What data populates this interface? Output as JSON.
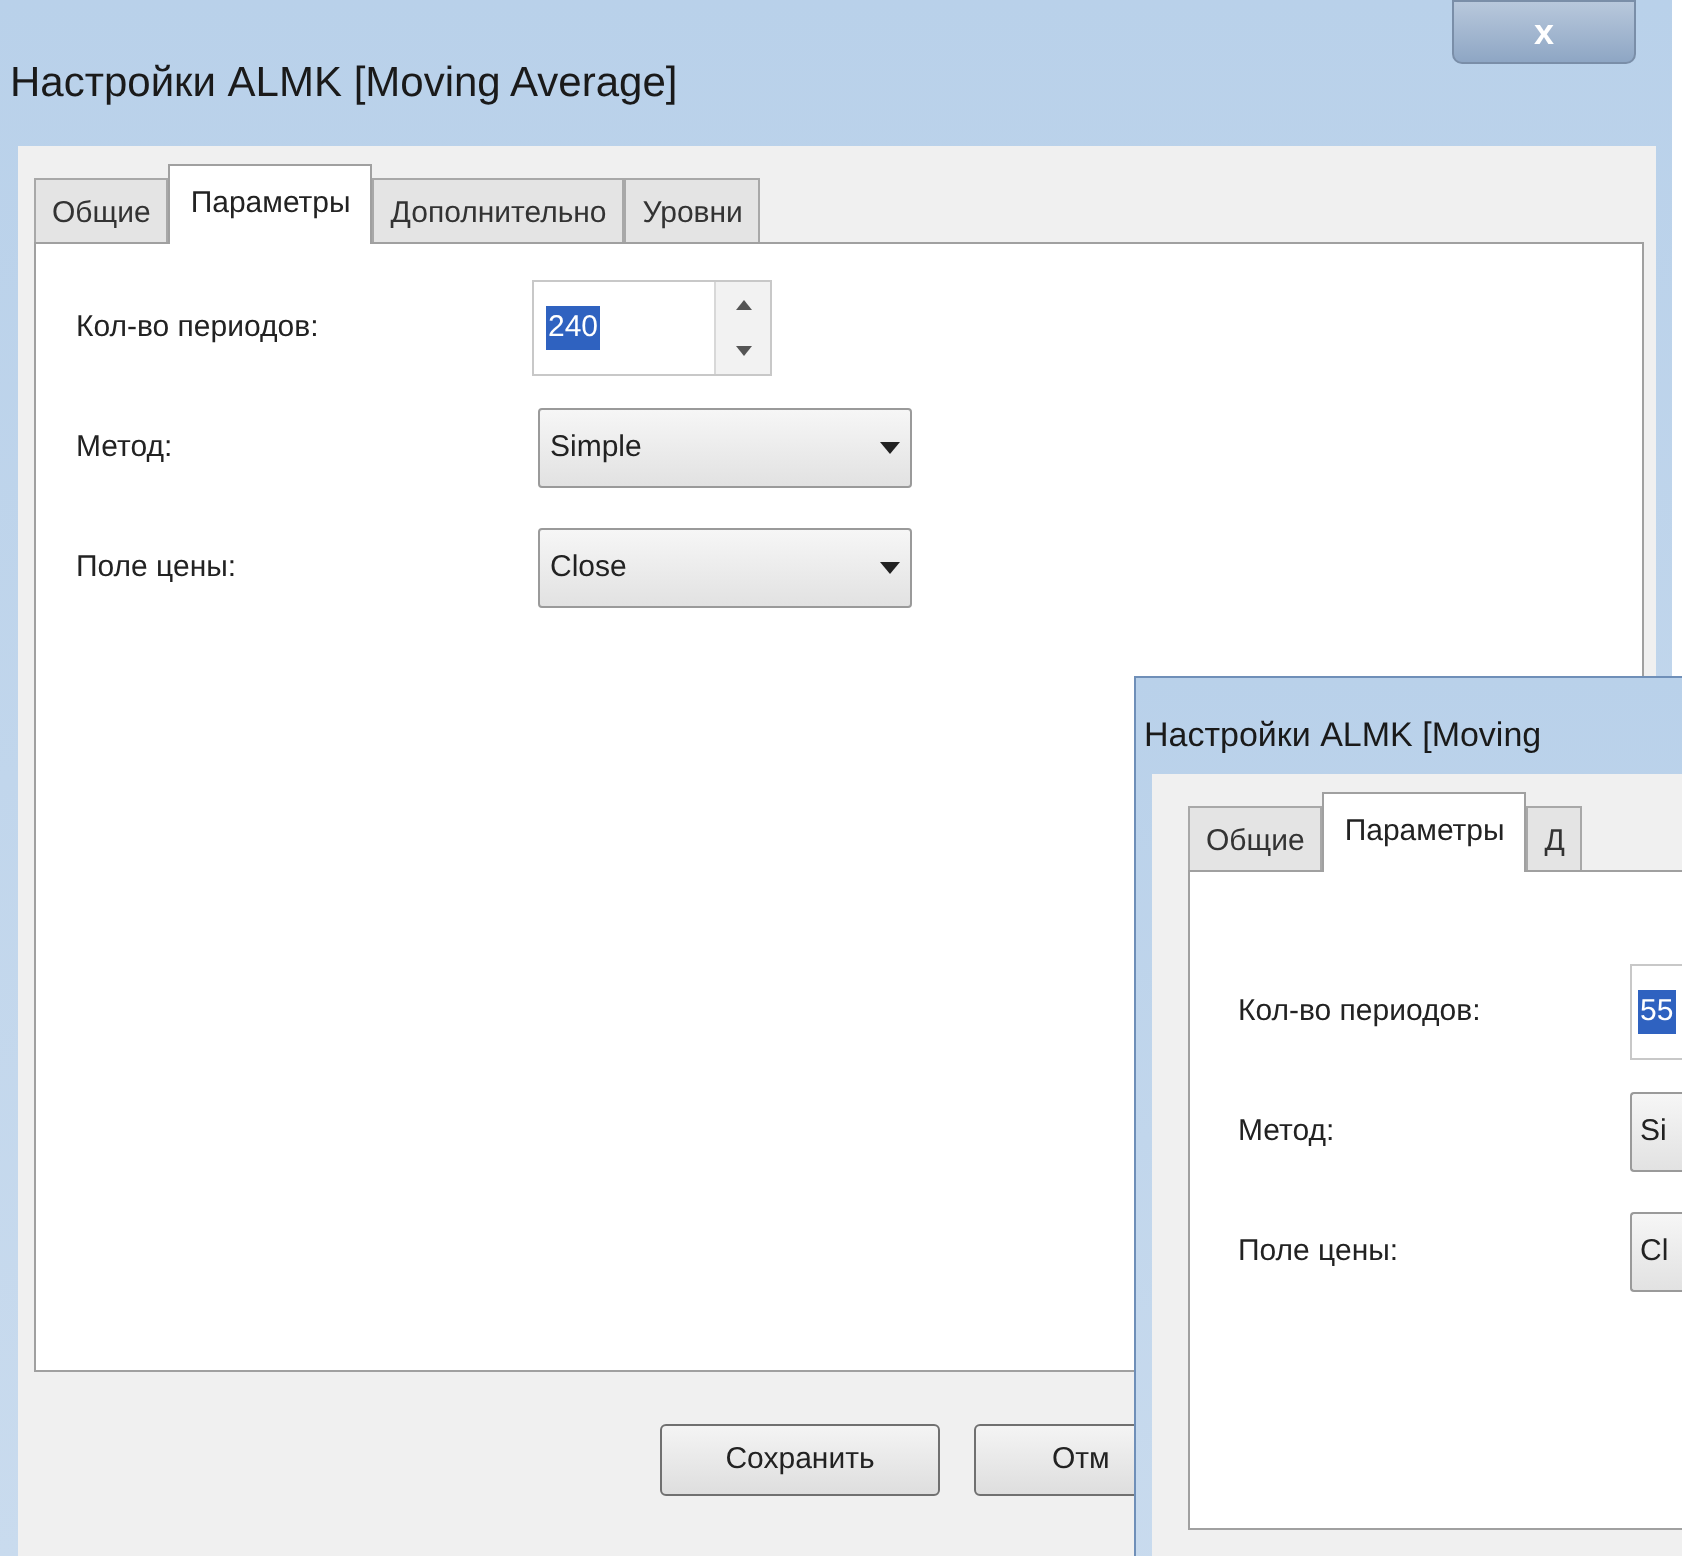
{
  "dialogs": [
    {
      "title": "Настройки ALMK [Moving Average]",
      "close": "x",
      "tabs": [
        {
          "label": "Общие",
          "selected": false
        },
        {
          "label": "Параметры",
          "selected": true
        },
        {
          "label": "Дополнительно",
          "selected": false
        },
        {
          "label": "Уровни",
          "selected": false
        }
      ],
      "fields": [
        {
          "kind": "spin",
          "label": "Кол-во периодов:",
          "value": "240"
        },
        {
          "kind": "dropdown",
          "label": "Метод:",
          "value": "Simple"
        },
        {
          "kind": "dropdown",
          "label": "Поле цены:",
          "value": "Close"
        }
      ],
      "buttons": [
        "Сохранить",
        "Отм"
      ]
    },
    {
      "title": "Настройки ALMK [Moving",
      "tabs": [
        {
          "label": "Общие",
          "selected": false
        },
        {
          "label": "Параметры",
          "selected": true
        },
        {
          "label": "Д",
          "selected": false
        }
      ],
      "fields": [
        {
          "kind": "spin",
          "label": "Кол-во периодов:",
          "value": "55"
        },
        {
          "kind": "dropdown",
          "label": "Метод:",
          "value": "Si"
        },
        {
          "kind": "dropdown",
          "label": "Поле цены:",
          "value": "Cl"
        }
      ]
    }
  ]
}
